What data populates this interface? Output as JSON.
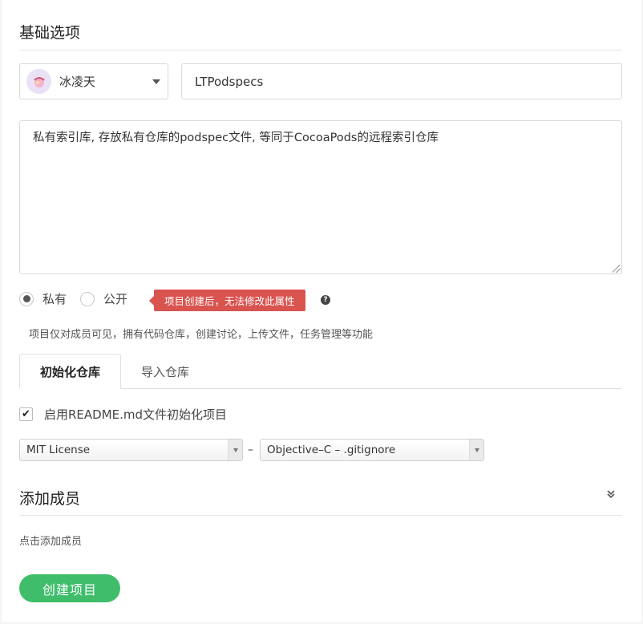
{
  "basic": {
    "title": "基础选项",
    "owner": {
      "name": "冰凌天",
      "avatar_icon": "avatar-icon"
    },
    "project_name": "LTPodspecs",
    "description": "私有索引库, 存放私有仓库的podspec文件, 等同于CocoaPods的远程索引仓库"
  },
  "visibility": {
    "private_label": "私有",
    "public_label": "公开",
    "selected": "private",
    "warning": "项目创建后，无法修改此属性",
    "hint": "项目仅对成员可见，拥有代码仓库，创建讨论，上传文件，任务管理等功能"
  },
  "tabs": [
    {
      "label": "初始化仓库",
      "active": true
    },
    {
      "label": "导入仓库",
      "active": false
    }
  ],
  "init": {
    "readme_label": "启用README.md文件初始化项目",
    "readme_checked": true,
    "license": "MIT License",
    "separator": "–",
    "gitignore": "Objective–C – .gitignore"
  },
  "members": {
    "title": "添加成员",
    "add_label": "点击添加成员"
  },
  "submit": {
    "label": "创建项目"
  },
  "colors": {
    "primary": "#3fbd6b",
    "warning": "#d9534f"
  }
}
